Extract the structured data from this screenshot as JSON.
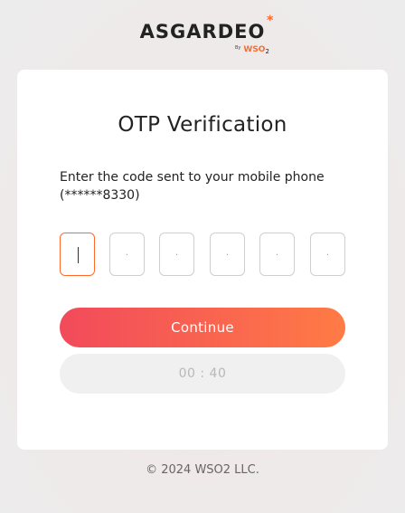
{
  "logo": {
    "name": "ASGARDEO",
    "by": "By",
    "brand": "WSO",
    "brand_suffix": "2",
    "star": "*"
  },
  "card": {
    "title": "OTP Verification",
    "description": "Enter the code sent to your mobile phone (******8330)",
    "otp_placeholders": [
      "",
      ".",
      ".",
      ".",
      ".",
      "."
    ],
    "continue_label": "Continue",
    "timer": "00 : 40"
  },
  "footer": {
    "copyright": "© 2024 WSO2 LLC."
  },
  "colors": {
    "accent_start": "#f24a5b",
    "accent_end": "#ff7b45",
    "active_border": "#ff6a2b"
  }
}
